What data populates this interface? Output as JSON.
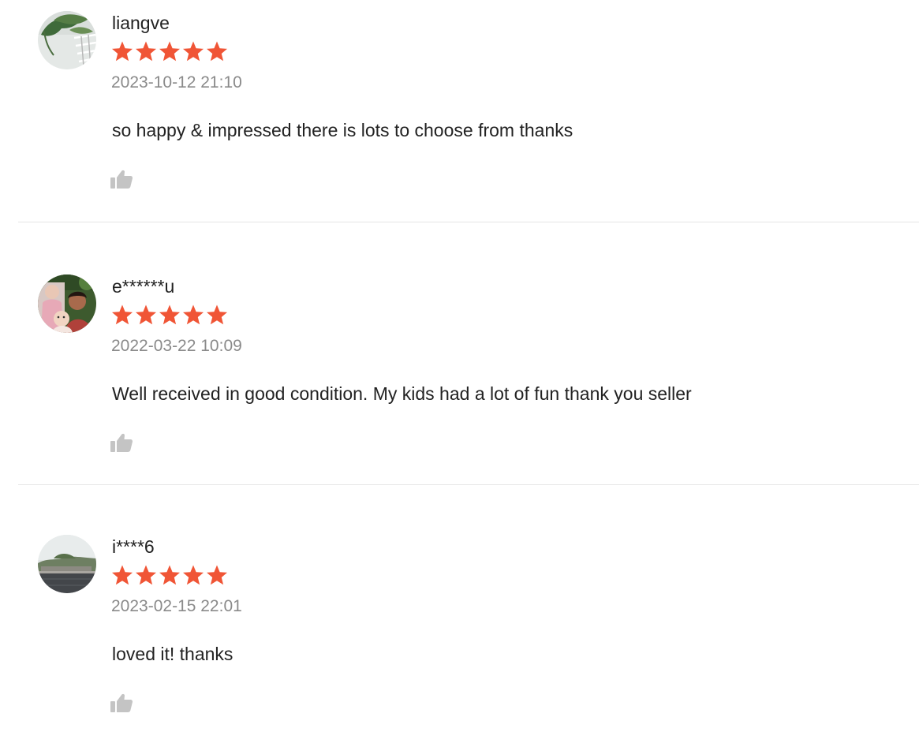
{
  "colors": {
    "star": "#f05536",
    "date": "#8a8a8a",
    "text": "#222222",
    "like_icon": "#c4c4c4",
    "divider": "#e6e6e6"
  },
  "reviews": [
    {
      "username": "liangve",
      "rating": 5,
      "date": "2023-10-12 21:10",
      "comment": "so happy & impressed there is lots to choose from thanks",
      "avatar_icon": "user-avatar-plant-photo",
      "like_icon": "thumbs-up-icon"
    },
    {
      "username": "e******u",
      "rating": 5,
      "date": "2022-03-22 10:09",
      "comment": "Well received in good condition. My kids had a lot of fun thank you seller",
      "avatar_icon": "user-avatar-family-photo",
      "like_icon": "thumbs-up-icon"
    },
    {
      "username": "i****6",
      "rating": 5,
      "date": "2023-02-15 22:01",
      "comment": "loved it! thanks",
      "avatar_icon": "user-avatar-landscape-photo",
      "like_icon": "thumbs-up-icon"
    }
  ]
}
